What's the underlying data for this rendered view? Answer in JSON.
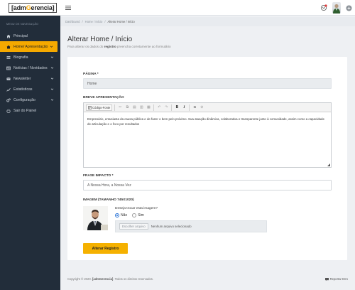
{
  "brand": {
    "prefix": "[adm",
    "accent": "G",
    "suffix": "erencia]"
  },
  "sidebar": {
    "section_title": "MENU DE NAVEGAÇÃO",
    "items": [
      {
        "label": "Principal",
        "icon": "home-icon",
        "has_children": false,
        "active": false
      },
      {
        "label": "Home/ Apresentação",
        "icon": "house-icon",
        "has_children": true,
        "active": true
      },
      {
        "label": "Biografia",
        "icon": "list-icon",
        "has_children": true,
        "active": false
      },
      {
        "label": "Notícias / Novidades",
        "icon": "newspaper-icon",
        "has_children": true,
        "active": false
      },
      {
        "label": "Newsletter",
        "icon": "envelope-icon",
        "has_children": true,
        "active": false
      },
      {
        "label": "Estatísticas",
        "icon": "chart-icon",
        "has_children": true,
        "active": false
      },
      {
        "label": "Configuração",
        "icon": "gears-icon",
        "has_children": true,
        "active": false
      },
      {
        "label": "Sair do Painel",
        "icon": "power-icon",
        "has_children": false,
        "active": false
      }
    ]
  },
  "breadcrumb": {
    "items": [
      "Dashboard",
      "Home / Início"
    ],
    "current": "Alterar Home / Início"
  },
  "page": {
    "title": "Alterar Home / Início",
    "subtitle_pre": "Para alterar os dados do ",
    "subtitle_bold": "registro",
    "subtitle_post": " preencha corretamente ao formulário"
  },
  "form": {
    "pagina_label": "PÁGINA *",
    "pagina_value": "Home",
    "breve_label": "BREVE APRESENTAÇÃO",
    "source_button": "Código-Fonte",
    "editor_text": "Empresário, entusiasta da causa pública e de fazer o bem pelo próximo. Sua atuação dinâmica, colaborativa e transparente junto à comunidade, assim como a capacidade de articulação e o foco por resultados",
    "frase_label": "FRASE IMPACTO *",
    "frase_value": "A Nossa Hora, a Nossa Vez",
    "imagem_label": "IMAGEM (TAMANHO 745X1020)",
    "trocar_question": "Deseja trocar esta imagem?",
    "radio_no": "Não",
    "radio_yes": "Sim",
    "radio_selected": "Não",
    "file_button": "Escolher arquivo",
    "file_status": "Nenhum arquivo selecionado",
    "submit_label": "Alterar Registro"
  },
  "footer": {
    "prefix": "Copyright © 2020. ",
    "brand": "[admGerencia]",
    "suffix": ". Todos os direitos reservados.",
    "report": "Reportar Erro"
  },
  "colors": {
    "accent": "#f5b100",
    "sidebar": "#222d3a",
    "radio": "#2a73d6"
  }
}
